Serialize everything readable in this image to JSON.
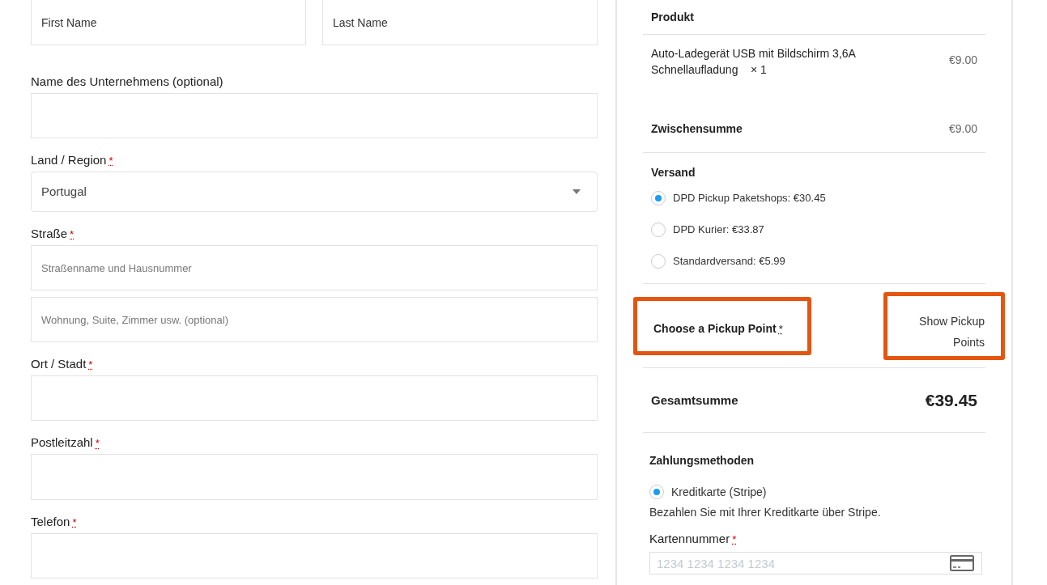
{
  "billing": {
    "name_fields": [
      {
        "placeholder": "First Name"
      },
      {
        "placeholder": "Last Name"
      }
    ],
    "fields": [
      {
        "kind": "text",
        "label": "Name des Unternehmens (optional)"
      },
      {
        "kind": "select",
        "label": "Land / Region",
        "required_mark": "*",
        "value": "Portugal"
      },
      {
        "kind": "text",
        "label": "Straße",
        "required_mark": "*",
        "placeholders": [
          "Straßenname und Hausnummer",
          "Wohnung, Suite, Zimmer usw. (optional)"
        ]
      },
      {
        "kind": "text",
        "label": "Ort / Stadt",
        "required_mark": "*"
      },
      {
        "kind": "text",
        "label": "Postleitzahl",
        "required_mark": "*"
      },
      {
        "kind": "text",
        "label": "Telefon",
        "required_mark": "*"
      }
    ]
  },
  "order": {
    "header": "Produkt",
    "item": {
      "name": "Auto-Ladegerät USB mit Bildschirm 3,6A Schnellaufladung",
      "quantity": "× 1",
      "price": "€9.00"
    },
    "subtotal": {
      "label": "Zwischensumme",
      "value": "€9.00"
    },
    "shipping": {
      "label": "Versand",
      "options": [
        {
          "label": "DPD Pickup Paketshops: €30.45",
          "selected": true
        },
        {
          "label": "DPD Kurier: €33.87",
          "selected": false
        },
        {
          "label": "Standardversand: €5.99",
          "selected": false
        }
      ]
    },
    "pickup": {
      "label": "Choose a Pickup Point",
      "required_mark": "*",
      "link": "Show Pickup Points",
      "label_highlighted": true,
      "link_highlighted": true
    },
    "total": {
      "label": "Gesamtsumme",
      "value": "€39.45"
    }
  },
  "payment": {
    "title": "Zahlungsmethoden",
    "methods": [
      {
        "label": "Kreditkarte (Stripe)",
        "selected": true
      }
    ],
    "description": "Bezahlen Sie mit Ihrer Kreditkarte über Stripe.",
    "card_label": "Kartennummer",
    "card_required_mark": "*",
    "card_placeholder": "1234 1234 1234 1234"
  }
}
